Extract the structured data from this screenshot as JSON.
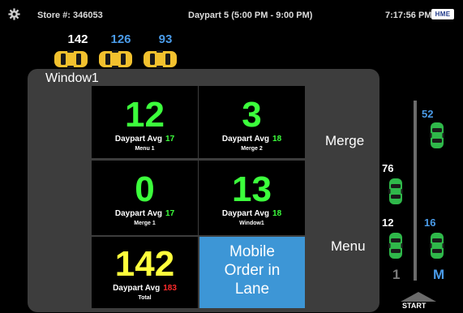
{
  "topbar": {
    "store": "Store #: 346053",
    "daypart": "Daypart 5 (5:00 PM - 9:00 PM)",
    "clock": "7:17:56 PM",
    "logo": "HME"
  },
  "queue": {
    "counts": [
      "142",
      "126",
      "93"
    ],
    "count_colors": [
      "#ffffff",
      "#4a9be8",
      "#4a9be8"
    ]
  },
  "panel": {
    "title": "Window1"
  },
  "tiles": [
    {
      "value": "12",
      "avg_label": "Daypart Avg",
      "avg_value": "17",
      "sub": "Menu 1",
      "value_color": "#3cff3c",
      "avg_color": "#3cff3c"
    },
    {
      "value": "3",
      "avg_label": "Daypart Avg",
      "avg_value": "18",
      "sub": "Merge 2",
      "value_color": "#3cff3c",
      "avg_color": "#3cff3c"
    },
    {
      "value": "0",
      "avg_label": "Daypart Avg",
      "avg_value": "17",
      "sub": "Merge 1",
      "value_color": "#3cff3c",
      "avg_color": "#3cff3c"
    },
    {
      "value": "13",
      "avg_label": "Daypart Avg",
      "avg_value": "18",
      "sub": "Window1",
      "value_color": "#3cff3c",
      "avg_color": "#3cff3c"
    },
    {
      "value": "142",
      "avg_label": "Daypart Avg",
      "avg_value": "183",
      "sub": "Total",
      "value_color": "#ffff3c",
      "avg_color": "#ff2b2b"
    }
  ],
  "mobile": {
    "line1": "Mobile",
    "line2": "Order in",
    "line3": "Lane"
  },
  "labels": {
    "merge": "Merge",
    "menu": "Menu"
  },
  "lanes": {
    "lane1_top": "76",
    "lane1_bottom": "12",
    "lane2_top": "52",
    "lane2_bottom": "16",
    "lane1_label": "1",
    "lane2_label": "M",
    "start": "START"
  },
  "colors": {
    "car_yellow": "#f2c12e",
    "car_green": "#2fb84a",
    "blue_text": "#4a9be8",
    "panel_bg": "#3d3d3d"
  }
}
